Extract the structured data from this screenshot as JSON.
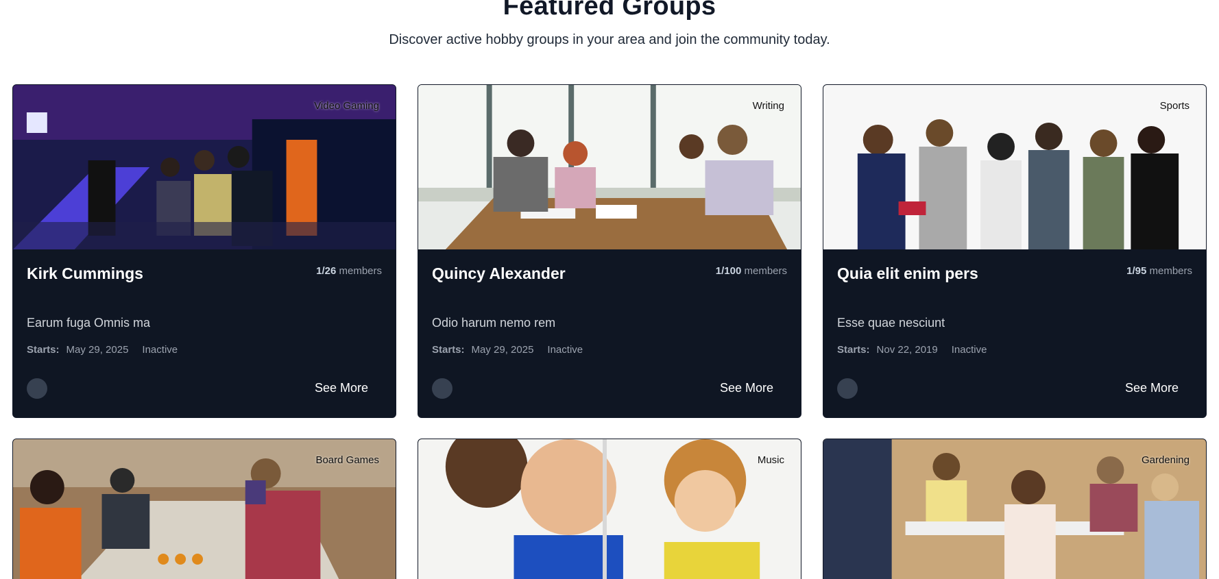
{
  "section": {
    "title": "Featured Groups",
    "subtitle": "Discover active hobby groups in your area and join the community today."
  },
  "cards": [
    {
      "category": "Video Gaming",
      "title": "Kirk Cummings",
      "members_count": "1/26",
      "members_label": "members",
      "description": "Earum fuga Omnis ma",
      "starts_label": "Starts:",
      "start_date": "May 29, 2025",
      "status": "Inactive",
      "cta": "See More"
    },
    {
      "category": "Writing",
      "title": "Quincy Alexander",
      "members_count": "1/100",
      "members_label": "members",
      "description": "Odio harum nemo rem",
      "starts_label": "Starts:",
      "start_date": "May 29, 2025",
      "status": "Inactive",
      "cta": "See More"
    },
    {
      "category": "Sports",
      "title": "Quia elit enim pers",
      "members_count": "1/95",
      "members_label": "members",
      "description": "Esse quae nesciunt",
      "starts_label": "Starts:",
      "start_date": "Nov 22, 2019",
      "status": "Inactive",
      "cta": "See More"
    },
    {
      "category": "Board Games"
    },
    {
      "category": "Music"
    },
    {
      "category": "Gardening"
    }
  ]
}
